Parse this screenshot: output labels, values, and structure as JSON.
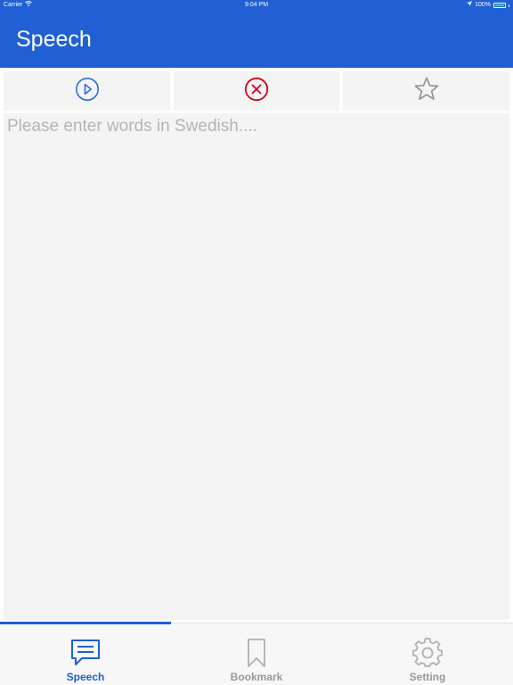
{
  "status_bar": {
    "carrier": "Carrier",
    "time": "9:04 PM",
    "battery": "100%"
  },
  "nav": {
    "title": "Speech"
  },
  "toolbar": {
    "play_icon": "play-circle-icon",
    "clear_icon": "close-circle-icon",
    "bookmark_icon": "star-outline-icon"
  },
  "editor": {
    "placeholder": "Please enter words in Swedish....",
    "value": ""
  },
  "tabs": [
    {
      "label": "Speech",
      "icon": "chat-bubble-icon",
      "active": true
    },
    {
      "label": "Bookmark",
      "icon": "bookmark-icon",
      "active": false
    },
    {
      "label": "Setting",
      "icon": "gear-icon",
      "active": false
    }
  ],
  "colors": {
    "accent": "#2060d4",
    "play": "#2a6fe0",
    "clear": "#d0021b",
    "star": "#8e8e8e",
    "inactive_tab": "#999999",
    "battery": "#4cd964"
  }
}
